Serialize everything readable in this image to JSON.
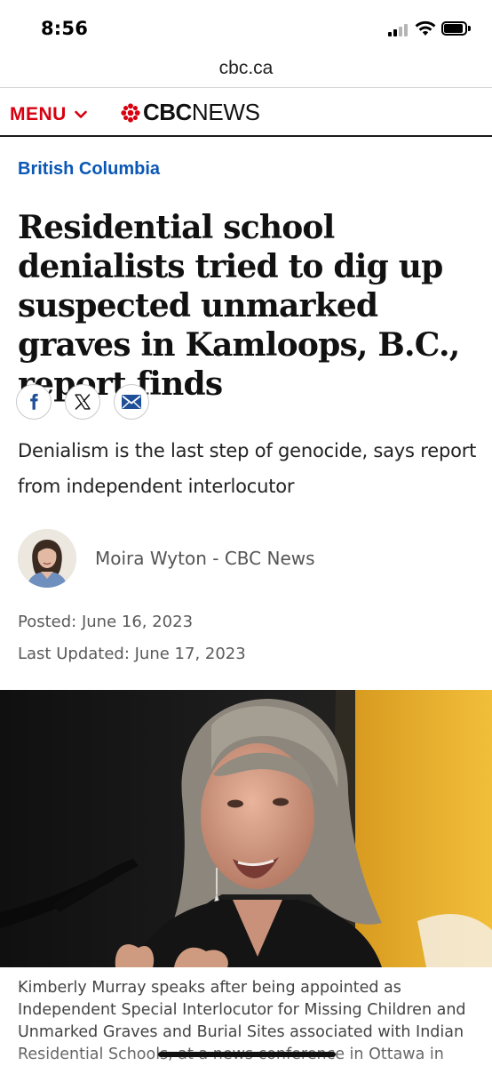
{
  "status_bar": {
    "time": "8:56"
  },
  "browser": {
    "url": "cbc.ca"
  },
  "header": {
    "menu_label": "MENU",
    "logo_text_bold": "CBC",
    "logo_text_light": "NEWS",
    "brand_color": "#d7000f"
  },
  "article": {
    "section": "British Columbia",
    "headline": "Residential school denialists tried to dig up suspected unmarked graves in Kamloops, B.C., report finds",
    "share_buttons": [
      {
        "icon": "facebook-icon"
      },
      {
        "icon": "x-icon"
      },
      {
        "icon": "email-icon"
      }
    ],
    "deck": "Denialism is the last step of genocide, says report from independent interlocutor",
    "byline": "Moira Wyton - CBC News",
    "posted": "Posted: June 16, 2023",
    "updated": "Last Updated: June 17, 2023",
    "caption": "Kimberly Murray speaks after being appointed as Independent Special Interlocutor for Missing Children and Unmarked Graves and Burial Sites associated with Indian Residential Schools, at a news conference in Ottawa in"
  },
  "colors": {
    "section_link": "#0b57b5",
    "accent_red": "#d7000f"
  }
}
